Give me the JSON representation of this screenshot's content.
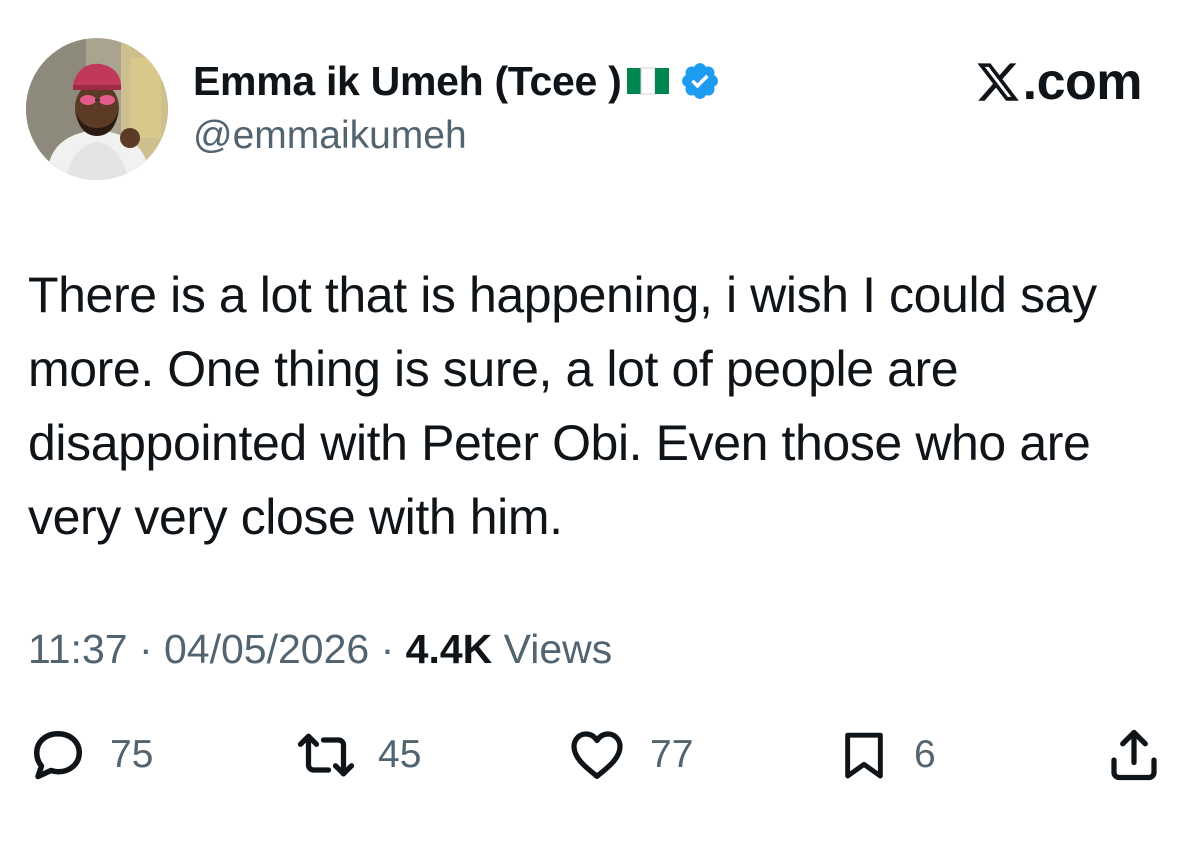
{
  "author": {
    "display_name": "Emma ik Umeh (Tcee )",
    "handle": "@emmaikumeh",
    "flag_icon": "nigeria-flag-icon",
    "verified_icon": "verified-badge-icon"
  },
  "brand": {
    "label": ".com"
  },
  "tweet": {
    "text": "There is a lot that is happening, i wish I could say more. One thing is sure, a lot of people are disappointed with Peter Obi. Even those who are very very close with him."
  },
  "meta": {
    "time": "11:37",
    "separator": " · ",
    "date": "04/05/2026",
    "views_count": "4.4K",
    "views_label": " Views"
  },
  "actions": {
    "replies": "75",
    "reposts": "45",
    "likes": "77",
    "bookmarks": "6"
  },
  "colors": {
    "primary_text": "#0f1419",
    "secondary_text": "#536471",
    "verified": "#1d9bf0",
    "flag_green": "#008751"
  }
}
